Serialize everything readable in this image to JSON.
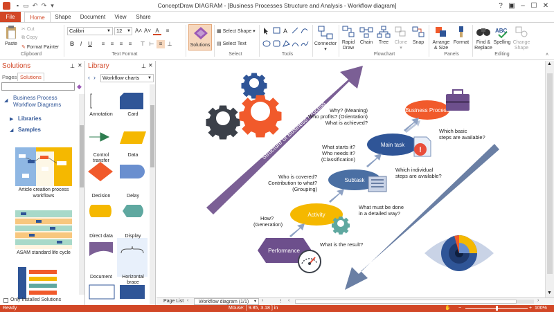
{
  "app": {
    "title": "ConceptDraw DIAGRAM - [Business Processes Structure and Analysis - Workflow diagram]",
    "accent": "#d24726"
  },
  "tabs": [
    "File",
    "Home",
    "Shape",
    "Document",
    "View",
    "Share"
  ],
  "ribbon": {
    "clipboard": {
      "paste": "Paste",
      "cut": "Cut",
      "copy": "Copy",
      "format_painter": "Format Painter",
      "group": "Clipboard"
    },
    "text_format": {
      "font": "Calibri",
      "size": "12",
      "group": "Text Format"
    },
    "solutions": {
      "label": "Solutions"
    },
    "select": {
      "select_shape": "Select Shape",
      "select_text": "Select Text",
      "group": "Select"
    },
    "tools": {
      "group": "Tools"
    },
    "connector": {
      "label": "Connector"
    },
    "flowchart": {
      "rapid_draw_1": "Rapid",
      "rapid_draw_2": "Draw",
      "chain": "Chain",
      "tree": "Tree",
      "clone": "Clone",
      "snap": "Snap",
      "group": "Flowchart"
    },
    "panels": {
      "arrange_1": "Arrange",
      "arrange_2": "& Size",
      "format": "Format",
      "group": "Panels"
    },
    "editing": {
      "find_1": "Find &",
      "find_2": "Replace",
      "spelling": "Spelling",
      "change_1": "Change",
      "change_2": "Shape",
      "group": "Editing"
    }
  },
  "solutions_panel": {
    "title": "Solutions",
    "tabs": [
      "Pages",
      "Solutions"
    ],
    "tree_title_1": "Business Process",
    "tree_title_2": "Workflow Diagrams",
    "libraries": "Libraries",
    "samples": "Samples",
    "sample_items": [
      {
        "label_1": "Article creation process",
        "label_2": "workflows"
      },
      {
        "label_1": "ASAM standard life cycle",
        "label_2": ""
      }
    ],
    "only_installed": "Only Installed Solutions"
  },
  "library_panel": {
    "title": "Library",
    "dropdown": "Workflow charts",
    "items": [
      {
        "label_1": "Annotation",
        "label_2": ""
      },
      {
        "label_1": "Card",
        "label_2": ""
      },
      {
        "label_1": "Control",
        "label_2": "transfer"
      },
      {
        "label_1": "Data",
        "label_2": ""
      },
      {
        "label_1": "Decision",
        "label_2": ""
      },
      {
        "label_1": "Delay",
        "label_2": ""
      },
      {
        "label_1": "Direct data",
        "label_2": ""
      },
      {
        "label_1": "Display",
        "label_2": ""
      },
      {
        "label_1": "Document",
        "label_2": ""
      },
      {
        "label_1": "Horizontal",
        "label_2": "brace"
      }
    ]
  },
  "diagram": {
    "structure_label": "Structure of Business Process",
    "analysis_label": "Analysis of Business Process",
    "nodes": {
      "business_process": "Business Process",
      "main_task": "Main task",
      "subtask": "Subtask",
      "activity": "Activity",
      "performance": "Performance"
    },
    "left_notes": {
      "bp_1": "Why? (Meaning)",
      "bp_2": "Who profits? (Orientation)",
      "bp_3": "What is achieved?",
      "mt_1": "What starts it?",
      "mt_2": "Who needs it?",
      "mt_3": "(Classification)",
      "st_1": "Who is covered?",
      "st_2": "Contribution to what?",
      "st_3": "(Grouping)",
      "ac_1": "How?",
      "ac_2": "(Generation)"
    },
    "right_notes": {
      "bp_1": "Which basic",
      "bp_2": "steps are available?",
      "mt_1": "Which individual",
      "mt_2": "steps are available?",
      "ac_1": "What must be done",
      "ac_2": "in a detailed way?",
      "pf_1": "What is the result?"
    },
    "colors": {
      "purple": "#7b5f95",
      "slate": "#6a7fa4",
      "orange": "#f15a2b",
      "ellipse_blue": "#2f5597",
      "subtask_blue": "#4a6fa3",
      "activity_yellow": "#f5b800",
      "performance_purple": "#6d4f8c",
      "gear_blue": "#2f5597",
      "gear_dark": "#3b4049",
      "gear_teal": "#5fa8a0"
    }
  },
  "page_bar": {
    "page_list": "Page List",
    "current": "Workflow diagram (1/1)"
  },
  "status": {
    "ready": "Ready",
    "mouse": "Mouse: [ 9.85, 3.18 ] in",
    "zoom": "100%"
  }
}
